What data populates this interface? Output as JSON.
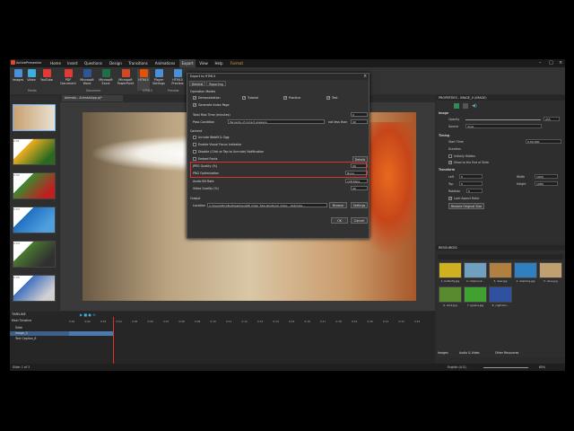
{
  "app": {
    "title": "ActivePresenter"
  },
  "menu": [
    "Home",
    "Insert",
    "Questions",
    "Design",
    "Transitions",
    "Animations",
    "Export",
    "View",
    "Help",
    "Format"
  ],
  "ribbon": {
    "buttons": [
      {
        "label": "Images",
        "color": "#4a90d9"
      },
      {
        "label": "Video",
        "color": "#3bb0e0"
      },
      {
        "label": "YouTube",
        "color": "#e53935"
      },
      {
        "label": "PDF Document",
        "color": "#e53935"
      },
      {
        "label": "Microsoft Word",
        "color": "#2b5797"
      },
      {
        "label": "Microsoft Excel",
        "color": "#1e7145"
      },
      {
        "label": "Microsoft PowerPoint",
        "color": "#d24726"
      },
      {
        "label": "HTML5",
        "color": "#e65100"
      },
      {
        "label": "Player Settings",
        "color": "#4a90d9"
      },
      {
        "label": "HTML5 Preview",
        "color": "#4a90d9"
      }
    ],
    "groups": [
      "Media",
      "Document",
      "HTML5",
      "Preview"
    ]
  },
  "document_tab": "Animals - AnimalsApp.pj*",
  "slides": [
    {
      "num": "0:00",
      "colors": [
        "#c8a070",
        "#e8e0d0"
      ]
    },
    {
      "num": "0:01",
      "colors": [
        "#f0b020",
        "#2a6a20"
      ]
    },
    {
      "num": "0:02",
      "colors": [
        "#3a8a30",
        "#c02020"
      ]
    },
    {
      "num": "0:03",
      "colors": [
        "#2070c0",
        "#50a0e0"
      ]
    },
    {
      "num": "0:04",
      "colors": [
        "#4a7a30",
        "#303030"
      ]
    },
    {
      "num": "0:05",
      "colors": [
        "#4070c0",
        "#d0d0d0"
      ]
    }
  ],
  "dialog": {
    "title": "Export to HTML5",
    "tabs": [
      "General",
      "Reporting"
    ],
    "operation_modes_label": "Operation Modes",
    "modes": [
      "Demonstration",
      "Tutorial",
      "Practice",
      "Test"
    ],
    "generate_index": "Generate Index Page",
    "total_max_time_label": "Total Max Time (minutes)",
    "total_max_time_value": "0",
    "pass_condition_label": "Pass Condition",
    "pass_condition_value": "Percents of correct answers",
    "not_less_than_label": "not less than",
    "not_less_than_value": "90",
    "content_label": "Content",
    "content_opts": [
      "Include WebM & Ogg",
      "Enable Visual Focus Indicator",
      "Disable (Click or Tap to Unmute) Notification",
      "Embed Fonts"
    ],
    "details_button": "Details",
    "jpeg_quality_label": "JPEG Quality (%)",
    "jpeg_quality_value": "90",
    "png_opt_label": "PNG Optimization",
    "png_opt_value": "None",
    "audio_bitrate_label": "Audio Bit Rate",
    "audio_bitrate_value": "128 Kbps",
    "video_quality_label": "Video Quality (%)",
    "video_quality_value": "90",
    "output_label": "Output",
    "location_label": "Location",
    "location_value": "C:\\Users\\MinhBui\\Desktop\\APR Video Tutorials\\Quick Video - Optimize...",
    "browse_button": "Browse",
    "settings_button": "Settings",
    "ok_button": "OK",
    "cancel_button": "Cancel"
  },
  "properties": {
    "title": "PROPERTIES - IMAGE_0 (IMAGE)",
    "image_section": "Image",
    "opacity_label": "Opacity",
    "opacity_value": "255",
    "source_label": "Source",
    "source_value": "dove",
    "timing_section": "Timing",
    "start_time_label": "Start Time",
    "start_time_value": "0:00.000",
    "duration_label": "Duration",
    "duration_value": "0:03.000",
    "initially_hidden": "Initially Hidden",
    "show_to_end": "Show to the End of Slide",
    "transform_section": "Transform",
    "left_label": "Left",
    "left_value": "0",
    "top_label": "Top",
    "top_value": "0",
    "width_label": "Width",
    "width_value": "1920",
    "height_label": "Height",
    "height_value": "1080",
    "rotation_label": "Rotation",
    "rotation_value": "0",
    "lock_aspect": "Lock Aspect Ratio",
    "restore_size": "Restore Original Size"
  },
  "resources": {
    "title": "RESOURCES",
    "items": [
      {
        "label": "1. butterfly.jpg",
        "color": "#d0b020"
      },
      {
        "label": "2. chipmunk...",
        "color": "#70a0c0"
      },
      {
        "label": "3. deer.jpg",
        "color": "#b08040"
      },
      {
        "label": "4. dolphing.jpg",
        "color": "#3080c0"
      },
      {
        "label": "5. dove.jpg",
        "color": "#c0a070"
      },
      {
        "label": "6. duck.jpg",
        "color": "#5a8a30"
      },
      {
        "label": "7. iguana.jpg",
        "color": "#40a030"
      },
      {
        "label": "8. night-blo...",
        "color": "#3050a0"
      }
    ],
    "tabs": [
      "Images",
      "Audio & Video",
      "Other Resources"
    ]
  },
  "timeline": {
    "title": "TIMELINE",
    "main_timeline": "Main Timeline",
    "rows": [
      "Slide",
      "Image_0",
      "Text Caption_6"
    ],
    "ticks": [
      "0:01",
      "0:02",
      "0:03",
      "0:04",
      "0:05",
      "0:06",
      "0:07",
      "0:08",
      "0:09",
      "0:10",
      "0:11",
      "0:12",
      "0:13",
      "0:14",
      "0:15",
      "0:16",
      "0:17",
      "0:18",
      "0:19",
      "0:20",
      "0:21",
      "0:22",
      "0:23"
    ]
  },
  "status": {
    "slide": "Slide: 1 of 3",
    "language": "English (U.S.)",
    "zoom": "65%"
  }
}
